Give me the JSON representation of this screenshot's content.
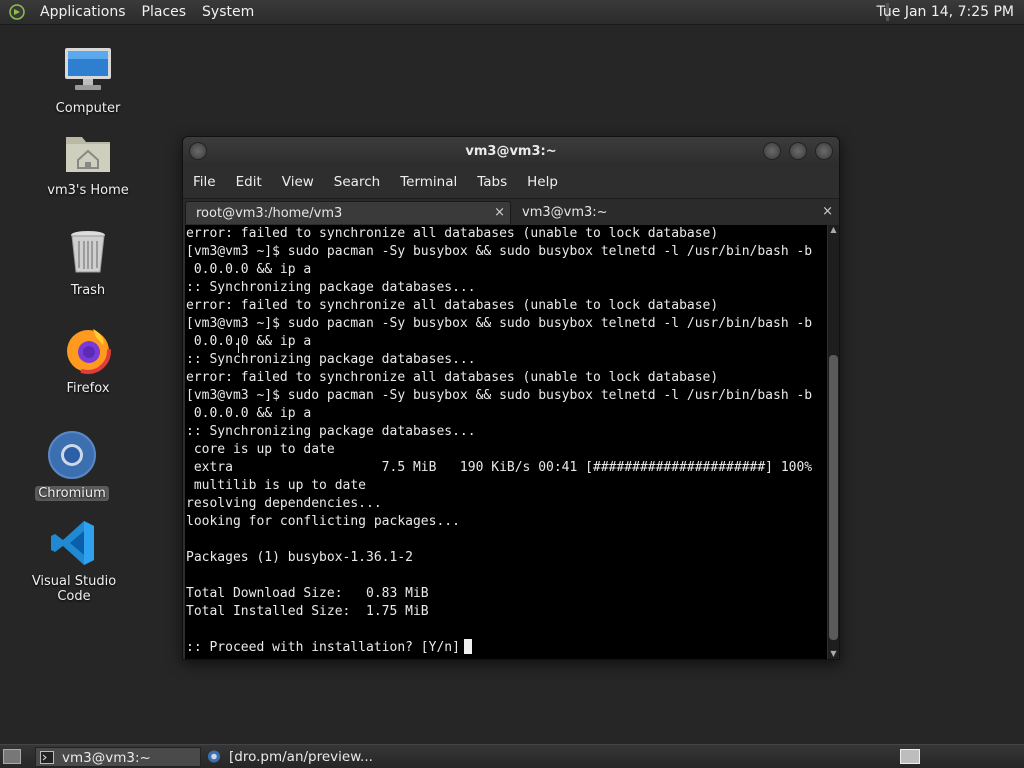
{
  "top_panel": {
    "menus": [
      "Applications",
      "Places",
      "System"
    ],
    "clock": "Tue Jan 14,  7:25 PM"
  },
  "desktop_icons": [
    {
      "label": "Computer",
      "icon": "computer-icon"
    },
    {
      "label": "vm3's Home",
      "icon": "home-folder-icon"
    },
    {
      "label": "Trash",
      "icon": "trash-icon"
    },
    {
      "label": "Firefox",
      "icon": "firefox-icon"
    },
    {
      "label": "Chromium",
      "icon": "chromium-icon",
      "selected": true
    },
    {
      "label": "Visual Studio Code",
      "icon": "vscode-icon"
    }
  ],
  "terminal_window": {
    "title": "vm3@vm3:~",
    "menus": [
      "File",
      "Edit",
      "View",
      "Search",
      "Terminal",
      "Tabs",
      "Help"
    ],
    "tabs": [
      {
        "label": "root@vm3:/home/vm3",
        "active": true
      },
      {
        "label": "vm3@vm3:~",
        "active": false
      }
    ],
    "tab_close_glyph": "×",
    "lines": [
      "error: failed to synchronize all databases (unable to lock database)",
      "[vm3@vm3 ~]$ sudo pacman -Sy busybox && sudo busybox telnetd -l /usr/bin/bash -b",
      " 0.0.0.0 && ip a",
      ":: Synchronizing package databases...",
      "error: failed to synchronize all databases (unable to lock database)",
      "[vm3@vm3 ~]$ sudo pacman -Sy busybox && sudo busybox telnetd -l /usr/bin/bash -b",
      " 0.0.0.0 && ip a",
      ":: Synchronizing package databases...",
      "error: failed to synchronize all databases (unable to lock database)",
      "[vm3@vm3 ~]$ sudo pacman -Sy busybox && sudo busybox telnetd -l /usr/bin/bash -b",
      " 0.0.0.0 && ip a",
      ":: Synchronizing package databases...",
      " core is up to date",
      " extra                   7.5 MiB   190 KiB/s 00:41 [######################] 100%",
      " multilib is up to date",
      "resolving dependencies...",
      "looking for conflicting packages...",
      "",
      "Packages (1) busybox-1.36.1-2",
      "",
      "Total Download Size:   0.83 MiB",
      "Total Installed Size:  1.75 MiB",
      "",
      ":: Proceed with installation? [Y/n]"
    ]
  },
  "taskbar": {
    "tasks": [
      {
        "label": "vm3@vm3:~",
        "icon": "terminal-icon",
        "active": true
      },
      {
        "label": "[dro.pm/an/preview...",
        "icon": "browser-icon",
        "active": false
      }
    ]
  },
  "colors": {
    "desktop_bg": "#262626",
    "terminal_bg": "#000000",
    "terminal_fg": "#eaeaea"
  }
}
